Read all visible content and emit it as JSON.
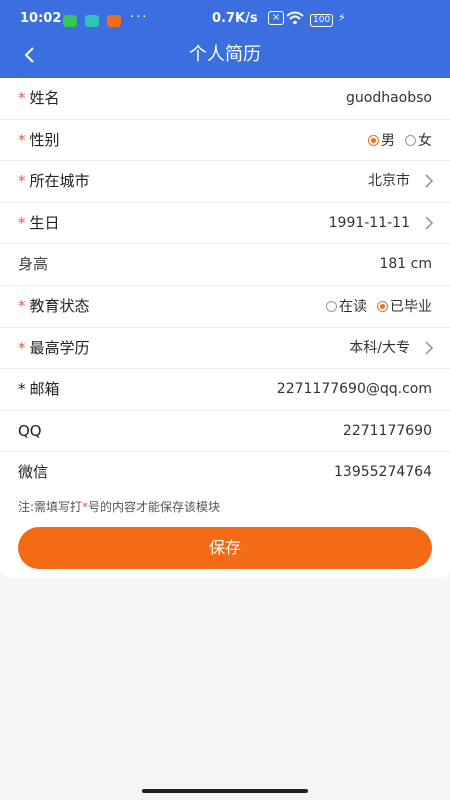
{
  "status_bar": {
    "time": "10:02",
    "dots": "···",
    "speed": "0.7K/s",
    "battery": "100"
  },
  "header": {
    "title": "个人简历"
  },
  "form": {
    "required_mark": "*",
    "name": {
      "label": "姓名",
      "value": "guodhaobso"
    },
    "gender": {
      "label": "性别",
      "options": [
        "男",
        "女"
      ],
      "selected": "男"
    },
    "city": {
      "label": "所在城市",
      "value": "北京市"
    },
    "birthday": {
      "label": "生日",
      "value": "1991-11-11"
    },
    "height": {
      "label": "身高",
      "value": "181 cm"
    },
    "education_status": {
      "label": "教育状态",
      "options": [
        "在读",
        "已毕业"
      ],
      "selected": "已毕业"
    },
    "degree": {
      "label": "最高学历",
      "value": "本科/大专"
    },
    "email": {
      "label": "邮箱",
      "value": "2271177690@qq.com"
    },
    "qq": {
      "label": "QQ",
      "value": "2271177690"
    },
    "wechat": {
      "label": "微信",
      "value": "13955274764"
    }
  },
  "note": {
    "prefix": "注:需填写打",
    "mark": "*",
    "suffix": "号的内容才能保存该模块"
  },
  "actions": {
    "save_label": "保存"
  },
  "colors": {
    "header_bg": "#3b6fe0",
    "accent": "#f46b15",
    "required": "#e7583a"
  }
}
